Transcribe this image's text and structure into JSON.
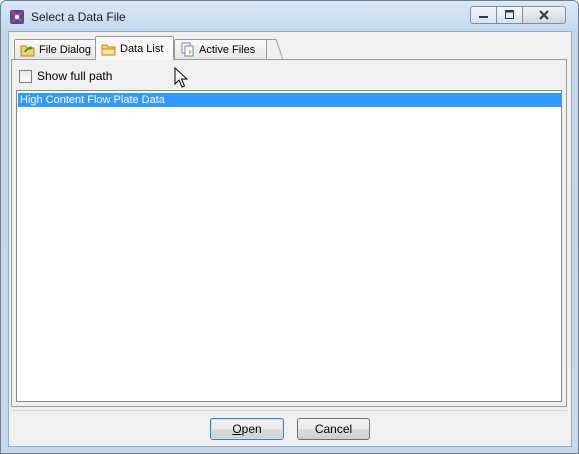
{
  "window": {
    "title": "Select a Data File",
    "app_icon": "flowjo-app-icon",
    "controls": [
      "minimize-icon",
      "maximize-icon",
      "close-icon"
    ]
  },
  "tabs": [
    {
      "label": "File Dialog",
      "icon": "folder-arrow-icon",
      "active": false
    },
    {
      "label": "Data List",
      "icon": "folder-icon",
      "active": true
    },
    {
      "label": "Active Files",
      "icon": "documents-icon",
      "active": false
    }
  ],
  "options": {
    "show_full_path_label": "Show full path",
    "show_full_path_checked": false
  },
  "list": {
    "items": [
      {
        "label": "High Content Flow Plate Data",
        "selected": true
      }
    ]
  },
  "buttons": {
    "open_label": "Open",
    "open_mnemonic": "O",
    "open_rest": "pen",
    "cancel_label": "Cancel"
  },
  "colors": {
    "selection": "#3399ff",
    "title_bar": "#c3d7ed",
    "close_button": "#cfd8e3"
  }
}
